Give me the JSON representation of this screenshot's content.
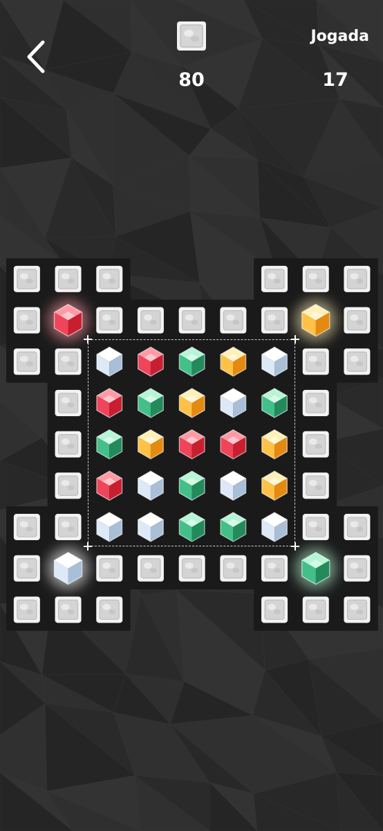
{
  "header": {
    "back_icon": "chevron-left-icon",
    "goal_icon": "ice-block-icon",
    "ice_remaining": "80",
    "moves_label": "Jogada",
    "moves_remaining": "17"
  },
  "colors": {
    "background": "#2b2b2b",
    "cell": "#1a1a1a",
    "red": "#e0303c",
    "green": "#3fb27f",
    "orange": "#f5a623",
    "white": "#c9d9ec"
  },
  "board": {
    "ice_blocks": [
      "r0c0",
      "r0c1",
      "r0c2",
      "r0c6",
      "r0c7",
      "r0c8",
      "r1c0",
      "r1c2",
      "r1c3",
      "r1c4",
      "r1c5",
      "r1c6",
      "r1c8",
      "r2c0",
      "r2c1",
      "r2c7",
      "r2c8",
      "r3c1",
      "r3c7",
      "r4c1",
      "r4c7",
      "r5c1",
      "r5c7",
      "r6c0",
      "r6c1",
      "r6c7",
      "r6c8",
      "r7c0",
      "r7c2",
      "r7c3",
      "r7c4",
      "r7c5",
      "r7c6",
      "r7c8",
      "r8c0",
      "r8c1",
      "r8c2",
      "r8c6",
      "r8c7",
      "r8c8"
    ],
    "glowing_gems": [
      {
        "cell": "r1c1",
        "color": "red"
      },
      {
        "cell": "r1c7",
        "color": "orange"
      },
      {
        "cell": "r7c1",
        "color": "white"
      },
      {
        "cell": "r7c7",
        "color": "green"
      }
    ],
    "gem_grid": [
      [
        "white",
        "red",
        "green",
        "orange",
        "white"
      ],
      [
        "red",
        "green",
        "orange",
        "white",
        "green"
      ],
      [
        "green",
        "orange",
        "red",
        "red",
        "orange"
      ],
      [
        "red",
        "white",
        "green",
        "white",
        "orange"
      ],
      [
        "white",
        "white",
        "green",
        "green",
        "white"
      ]
    ]
  }
}
